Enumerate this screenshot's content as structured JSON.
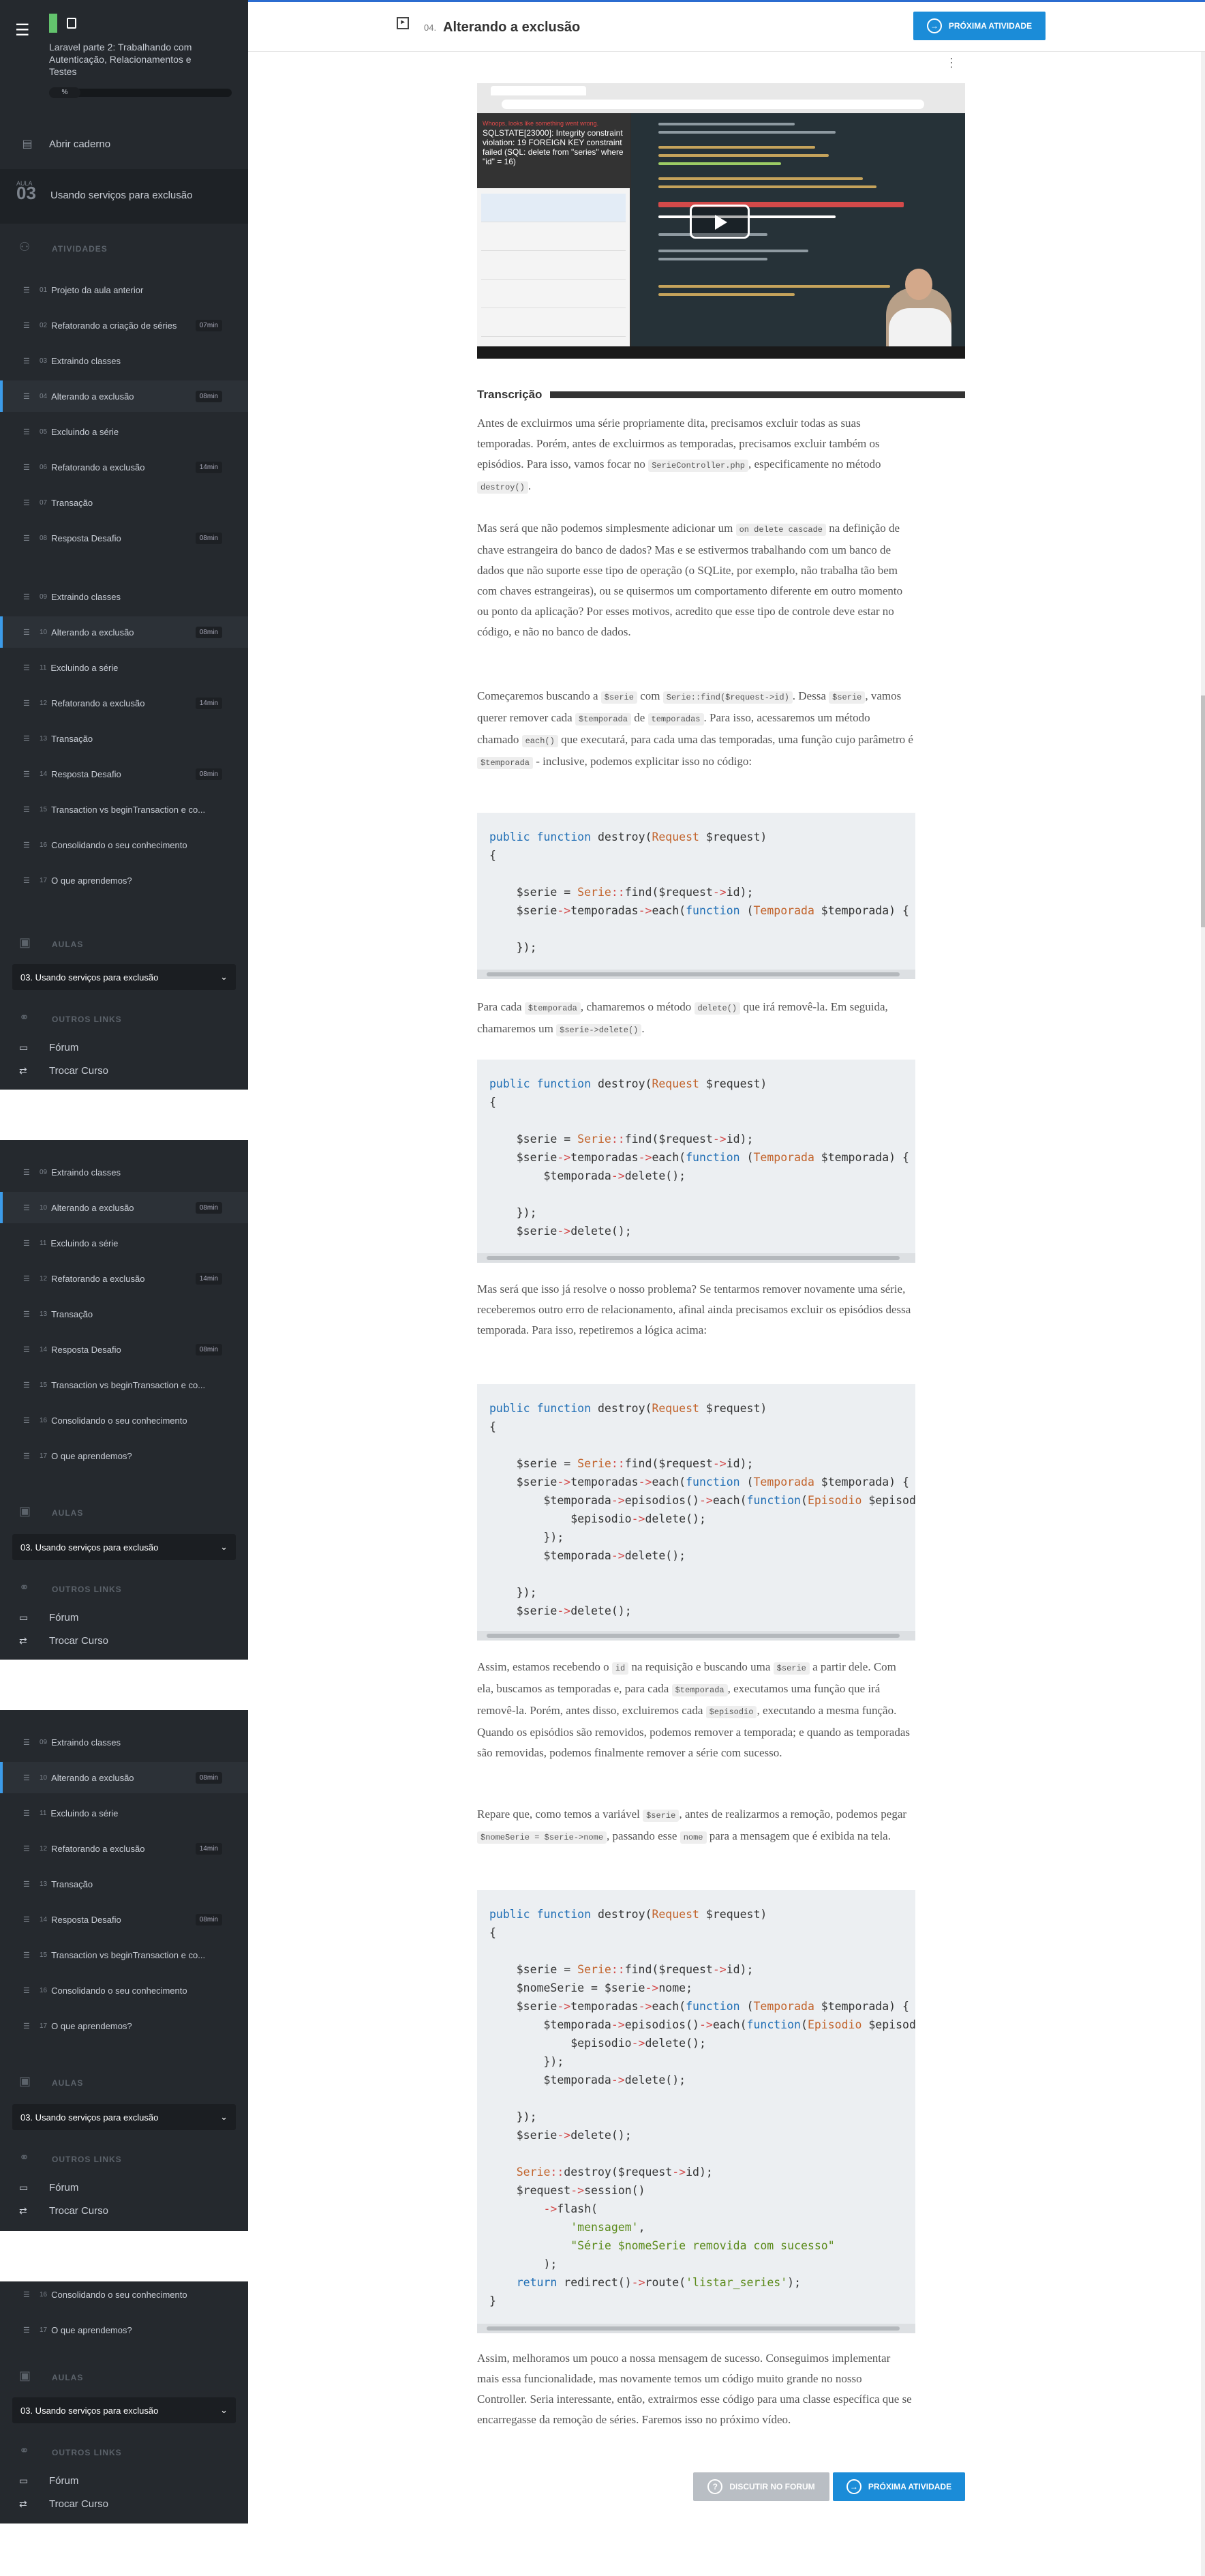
{
  "course": {
    "title": "Laravel parte 2: Trabalhando com Autenticação, Relacionamentos e Testes",
    "progress_label": "%"
  },
  "sidebar": {
    "notebook_label": "Abrir caderno",
    "section_small": "AULA",
    "section_number": "03",
    "section_title": "Usando serviços para exclusão",
    "activities_heading": "ATIVIDADES",
    "activities_full": [
      {
        "num": "01",
        "label": "Projeto da aula anterior",
        "badge": ""
      },
      {
        "num": "02",
        "label": "Refatorando a criação de séries",
        "badge": "07min"
      },
      {
        "num": "03",
        "label": "Extraindo classes",
        "badge": ""
      },
      {
        "num": "04",
        "label": "Alterando a exclusão",
        "badge": "08min"
      },
      {
        "num": "05",
        "label": "Excluindo a série",
        "badge": ""
      },
      {
        "num": "06",
        "label": "Refatorando a exclusão",
        "badge": "14min"
      },
      {
        "num": "07",
        "label": "Transação",
        "badge": ""
      },
      {
        "num": "08",
        "label": "Resposta Desafio",
        "badge": "08min"
      },
      {
        "num": "09",
        "label": "Extraindo classes",
        "badge": ""
      },
      {
        "num": "10",
        "label": "Alterando a exclusão",
        "badge": "08min"
      },
      {
        "num": "11",
        "label": "Excluindo a série",
        "badge": ""
      },
      {
        "num": "12",
        "label": "Refatorando a exclusão",
        "badge": "14min"
      },
      {
        "num": "13",
        "label": "Transação",
        "badge": ""
      },
      {
        "num": "14",
        "label": "Resposta Desafio",
        "badge": "08min"
      },
      {
        "num": "15",
        "label": "Transaction vs beginTransaction e co...",
        "badge": ""
      },
      {
        "num": "16",
        "label": "Consolidando o seu conhecimento",
        "badge": ""
      },
      {
        "num": "17",
        "label": "O que aprendemos?",
        "badge": ""
      }
    ],
    "activities_short": [
      {
        "num": "09",
        "label": "Extraindo classes",
        "badge": ""
      },
      {
        "num": "10",
        "label": "Alterando a exclusão",
        "badge": "08min"
      },
      {
        "num": "11",
        "label": "Excluindo a série",
        "badge": ""
      },
      {
        "num": "12",
        "label": "Refatorando a exclusão",
        "badge": "14min"
      },
      {
        "num": "13",
        "label": "Transação",
        "badge": ""
      },
      {
        "num": "14",
        "label": "Resposta Desafio",
        "badge": "08min"
      },
      {
        "num": "15",
        "label": "Transaction vs beginTransaction e co...",
        "badge": ""
      },
      {
        "num": "16",
        "label": "Consolidando o seu conhecimento",
        "badge": ""
      },
      {
        "num": "17",
        "label": "O que aprendemos?",
        "badge": ""
      }
    ],
    "activities_tail": [
      {
        "num": "16",
        "label": "Consolidando o seu conhecimento",
        "badge": ""
      },
      {
        "num": "17",
        "label": "O que aprendemos?",
        "badge": ""
      }
    ],
    "lessons_heading": "AULAS",
    "lesson_select": "03. Usando serviços para exclusão",
    "links_heading": "OUTROS LINKS",
    "forum_label": "Fórum",
    "switch_label": "Trocar Curso"
  },
  "header": {
    "activity_number": "04.",
    "activity_title": "Alterando a exclusão",
    "next_label": "PRÓXIMA ATIVIDADE"
  },
  "video": {
    "error_text": "SQLSTATE[23000]: Integrity constraint violation: 19 FOREIGN KEY constraint failed (SQL: delete from \"series\" where \"id\" = 16)",
    "error_small": "Whoops, looks like something went wrong."
  },
  "transcript": {
    "heading": "Transcrição",
    "p1": [
      {
        "t": "text",
        "v": "Antes de excluirmos uma série propriamente dita, precisamos excluir todas as suas temporadas. Porém, antes de excluirmos as temporadas, precisamos excluir também os episódios. Para isso, vamos focar no "
      },
      {
        "t": "code",
        "v": "SerieController.php"
      },
      {
        "t": "text",
        "v": ", especificamente no método "
      },
      {
        "t": "code",
        "v": "destroy()"
      },
      {
        "t": "text",
        "v": "."
      }
    ],
    "p2": [
      {
        "t": "text",
        "v": "Mas será que não podemos simplesmente adicionar um "
      },
      {
        "t": "code",
        "v": "on delete cascade"
      },
      {
        "t": "text",
        "v": " na definição de chave estrangeira do banco de dados? Mas e se estivermos trabalhando com um banco de dados que não suporte esse tipo de operação (o SQLite, por exemplo, não trabalha tão bem com chaves estrangeiras), ou se quisermos um comportamento diferente em outro momento ou ponto da aplicação? Por esses motivos, acredito que esse tipo de controle deve estar no código, e não no banco de dados."
      }
    ],
    "p3": [
      {
        "t": "text",
        "v": "Começaremos buscando a "
      },
      {
        "t": "code",
        "v": "$serie"
      },
      {
        "t": "text",
        "v": " com "
      },
      {
        "t": "code",
        "v": "Serie::find($request->id)"
      },
      {
        "t": "text",
        "v": ". Dessa "
      },
      {
        "t": "code",
        "v": "$serie"
      },
      {
        "t": "text",
        "v": ", vamos querer remover cada "
      },
      {
        "t": "code",
        "v": "$temporada"
      },
      {
        "t": "text",
        "v": " de "
      },
      {
        "t": "code",
        "v": "temporadas"
      },
      {
        "t": "text",
        "v": ". Para isso, acessaremos um método chamado "
      },
      {
        "t": "code",
        "v": "each()"
      },
      {
        "t": "text",
        "v": " que executará, para cada uma das temporadas, uma função cujo parâmetro é "
      },
      {
        "t": "code",
        "v": "$temporada"
      },
      {
        "t": "text",
        "v": " - inclusive, podemos explicitar isso no código:"
      }
    ],
    "p4": [
      {
        "t": "text",
        "v": "Para cada "
      },
      {
        "t": "code",
        "v": "$temporada"
      },
      {
        "t": "text",
        "v": ", chamaremos o método "
      },
      {
        "t": "code",
        "v": "delete()"
      },
      {
        "t": "text",
        "v": " que irá removê-la. Em seguida, chamaremos um "
      },
      {
        "t": "code",
        "v": "$serie->delete()"
      },
      {
        "t": "text",
        "v": "."
      }
    ],
    "p5": [
      {
        "t": "text",
        "v": "Mas será que isso já resolve o nosso problema? Se tentarmos remover novamente uma série, receberemos outro erro de relacionamento, afinal ainda precisamos excluir os episódios dessa temporada. Para isso, repetiremos a lógica acima:"
      }
    ],
    "p6": [
      {
        "t": "text",
        "v": "Assim, estamos recebendo o "
      },
      {
        "t": "code",
        "v": "id"
      },
      {
        "t": "text",
        "v": " na requisição e buscando uma "
      },
      {
        "t": "code",
        "v": "$serie"
      },
      {
        "t": "text",
        "v": " a partir dele. Com ela, buscamos as temporadas e, para cada "
      },
      {
        "t": "code",
        "v": "$temporada"
      },
      {
        "t": "text",
        "v": ", executamos uma função que irá removê-la. Porém, antes disso, excluiremos cada "
      },
      {
        "t": "code",
        "v": "$episodio"
      },
      {
        "t": "text",
        "v": ", executando a mesma função. Quando os episódios são removidos, podemos remover a temporada; e quando as temporadas são removidas, podemos finalmente remover a série com sucesso."
      }
    ],
    "p7": [
      {
        "t": "text",
        "v": "Repare que, como temos a variável "
      },
      {
        "t": "code",
        "v": "$serie"
      },
      {
        "t": "text",
        "v": ", antes de realizarmos a remoção, podemos pegar "
      },
      {
        "t": "code",
        "v": "$nomeSerie = $serie->nome"
      },
      {
        "t": "text",
        "v": ", passando esse "
      },
      {
        "t": "code",
        "v": "nome"
      },
      {
        "t": "text",
        "v": " para a mensagem que é exibida na tela."
      }
    ],
    "p8": [
      {
        "t": "text",
        "v": "Assim, melhoramos um pouco a nossa mensagem de sucesso. Conseguimos implementar mais essa funcionalidade, mas novamente temos um código muito grande no nosso Controller. Seria interessante, então, extrairmos esse código para uma classe específica que se encarregasse da remoção de séries. Faremos isso no próximo vídeo."
      }
    ],
    "code1": [
      "public function destroy(Request $request)",
      "{",
      "",
      "    $serie = Serie::find($request->id);",
      "    $serie->temporadas->each(function (Temporada $temporada) {",
      "",
      "    });"
    ],
    "code2": [
      "public function destroy(Request $request)",
      "{",
      "",
      "    $serie = Serie::find($request->id);",
      "    $serie->temporadas->each(function (Temporada $temporada) {",
      "        $temporada->delete();",
      "",
      "    });",
      "    $serie->delete();"
    ],
    "code3": [
      "public function destroy(Request $request)",
      "{",
      "",
      "    $serie = Serie::find($request->id);",
      "    $serie->temporadas->each(function (Temporada $temporada) {",
      "        $temporada->episodios()->each(function(Episodio $episodio) {",
      "            $episodio->delete();",
      "        });",
      "        $temporada->delete();",
      "",
      "    });",
      "    $serie->delete();"
    ],
    "code4": [
      "public function destroy(Request $request)",
      "{",
      "",
      "    $serie = Serie::find($request->id);",
      "    $nomeSerie = $serie->nome;",
      "    $serie->temporadas->each(function (Temporada $temporada) {",
      "        $temporada->episodios()->each(function(Episodio $episodio) {",
      "            $episodio->delete();",
      "        });",
      "        $temporada->delete();",
      "",
      "    });",
      "    $serie->delete();",
      "",
      "    Serie::destroy($request->id);",
      "    $request->session()",
      "        ->flash(",
      "            'mensagem',",
      "            \"Série $nomeSerie removida com sucesso\"",
      "        );",
      "    return redirect()->route('listar_series');",
      "}"
    ]
  },
  "footer": {
    "forum_button": "DISCUTIR NO FORUM",
    "next_button": "PRÓXIMA ATIVIDADE"
  }
}
